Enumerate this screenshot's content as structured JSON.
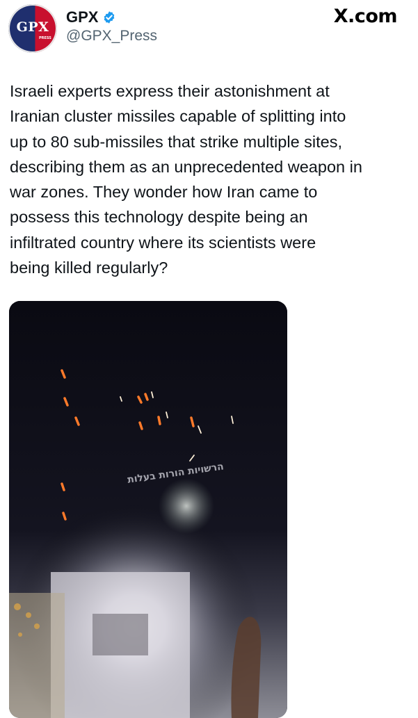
{
  "site_label": "X.com",
  "author": {
    "name": "GPX",
    "handle": "@GPX_Press",
    "avatar_text": "GPX",
    "avatar_subtext": "PRESS",
    "verified": true,
    "verified_icon": "verified-badge-icon",
    "verified_color": "#1d9bf0"
  },
  "tweet": {
    "text": "Israeli experts express their astonishment at\nIranian cluster missiles capable of splitting into\nup to 80 sub-missiles that strike multiple sites,\ndescribing them as an unprecedented weapon in\nwar zones. They wonder how Iran came to\npossess this technology despite being an\ninfiltrated country where its scientists were\nbeing killed regularly?",
    "media": {
      "type": "video-still",
      "overlay_caption": "הרשויות הורות בעלות"
    }
  },
  "colors": {
    "text": "#0f1419",
    "secondary_text": "#536471",
    "avatar_blue": "#1f2f6e",
    "avatar_red": "#c8102e"
  }
}
